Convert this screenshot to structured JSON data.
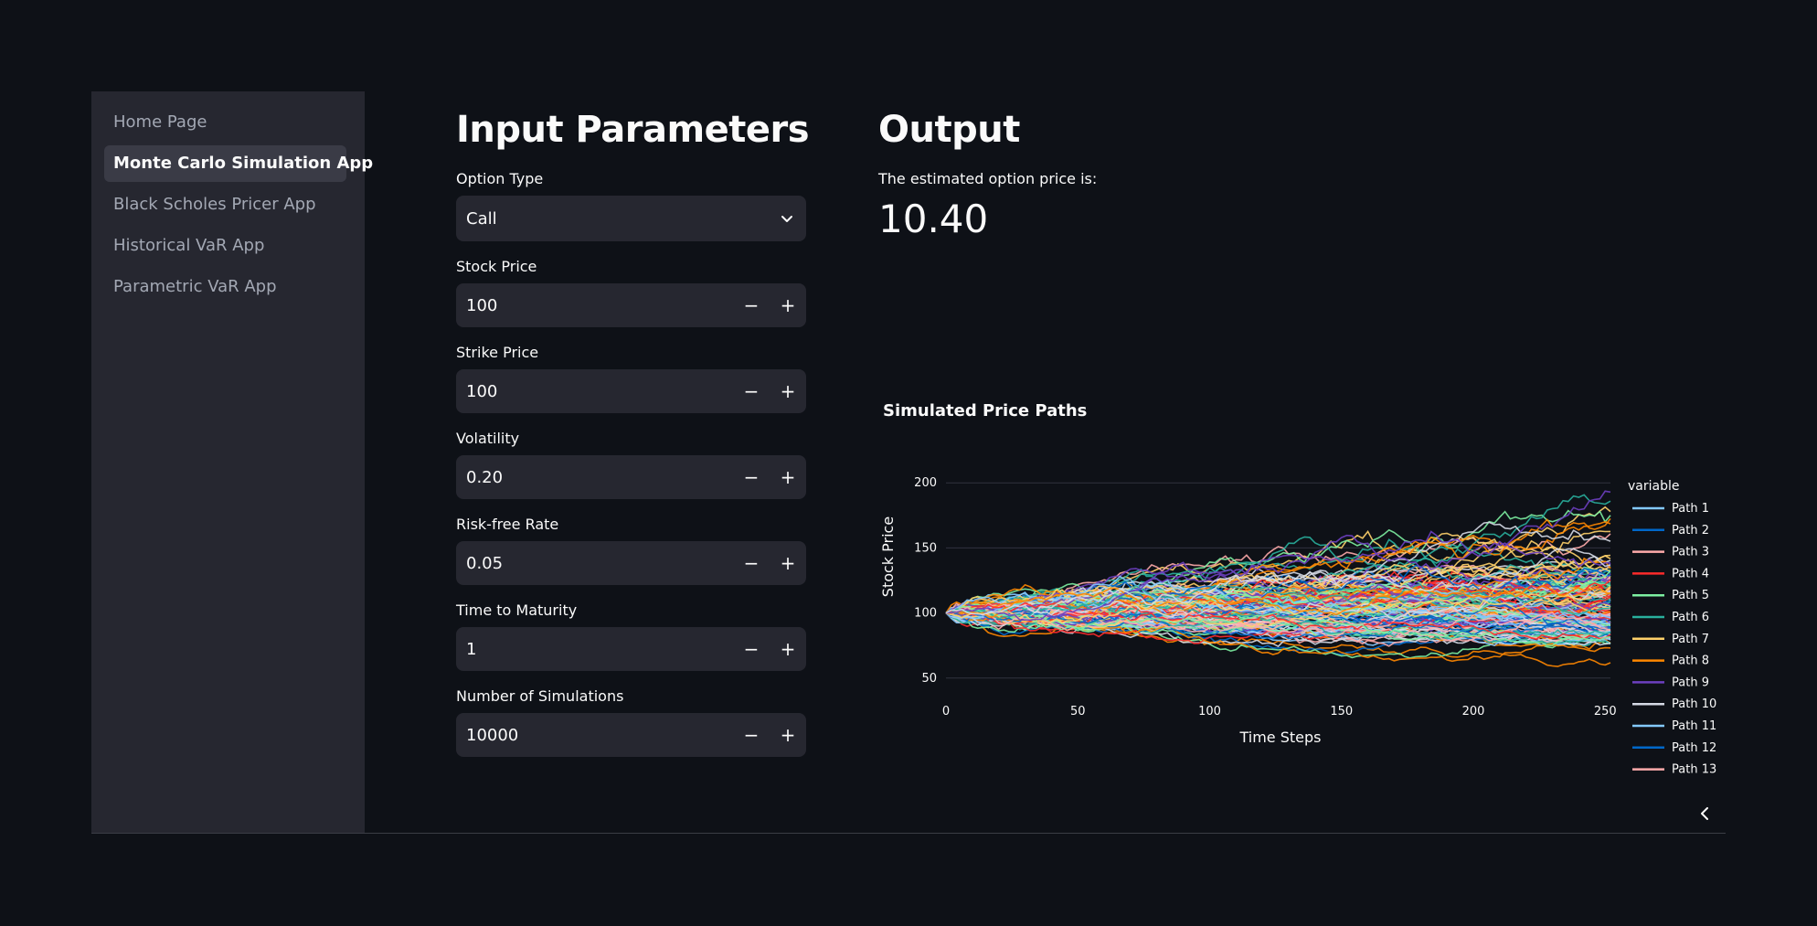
{
  "sidebar": {
    "items": [
      {
        "label": "Home Page",
        "active": false
      },
      {
        "label": "Monte Carlo Simulation App",
        "active": true
      },
      {
        "label": "Black Scholes Pricer App",
        "active": false
      },
      {
        "label": "Historical VaR App",
        "active": false
      },
      {
        "label": "Parametric VaR App",
        "active": false
      }
    ]
  },
  "inputs": {
    "title": "Input Parameters",
    "option_type": {
      "label": "Option Type",
      "value": "Call"
    },
    "stock_price": {
      "label": "Stock Price",
      "value": "100"
    },
    "strike_price": {
      "label": "Strike Price",
      "value": "100"
    },
    "volatility": {
      "label": "Volatility",
      "value": "0.20"
    },
    "risk_free_rate": {
      "label": "Risk-free Rate",
      "value": "0.05"
    },
    "time_to_maturity": {
      "label": "Time to Maturity",
      "value": "1"
    },
    "num_simulations": {
      "label": "Number of Simulations",
      "value": "10000"
    },
    "minus": "−",
    "plus": "+"
  },
  "output": {
    "title": "Output",
    "text": "The estimated option price is:",
    "value": "10.40"
  },
  "chart_data": {
    "type": "line",
    "title": "Simulated Price Paths",
    "xlabel": "Time Steps",
    "ylabel": "Stock Price",
    "xlim": [
      0,
      252
    ],
    "ylim": [
      40,
      210
    ],
    "x_ticks": [
      "0",
      "50",
      "100",
      "150",
      "200",
      "250"
    ],
    "y_ticks": [
      "50",
      "100",
      "150",
      "200"
    ],
    "legend_title": "variable",
    "legend_position": "right",
    "grid": true,
    "series": [
      {
        "name": "Path 1",
        "color": "#83c9ff"
      },
      {
        "name": "Path 2",
        "color": "#0068c9"
      },
      {
        "name": "Path 3",
        "color": "#ffabab"
      },
      {
        "name": "Path 4",
        "color": "#ff2b2b"
      },
      {
        "name": "Path 5",
        "color": "#7defa1"
      },
      {
        "name": "Path 6",
        "color": "#29b09d"
      },
      {
        "name": "Path 7",
        "color": "#ffd16a"
      },
      {
        "name": "Path 8",
        "color": "#ff8700"
      },
      {
        "name": "Path 9",
        "color": "#6d3fc0"
      },
      {
        "name": "Path 10",
        "color": "#d5dae5"
      },
      {
        "name": "Path 11",
        "color": "#83c9ff"
      },
      {
        "name": "Path 12",
        "color": "#0068c9"
      },
      {
        "name": "Path 13",
        "color": "#ffabab"
      }
    ]
  },
  "colors": {
    "background": "#0e1117",
    "sidebar": "#262730",
    "input_bg": "#262730",
    "text": "#fafafa"
  }
}
